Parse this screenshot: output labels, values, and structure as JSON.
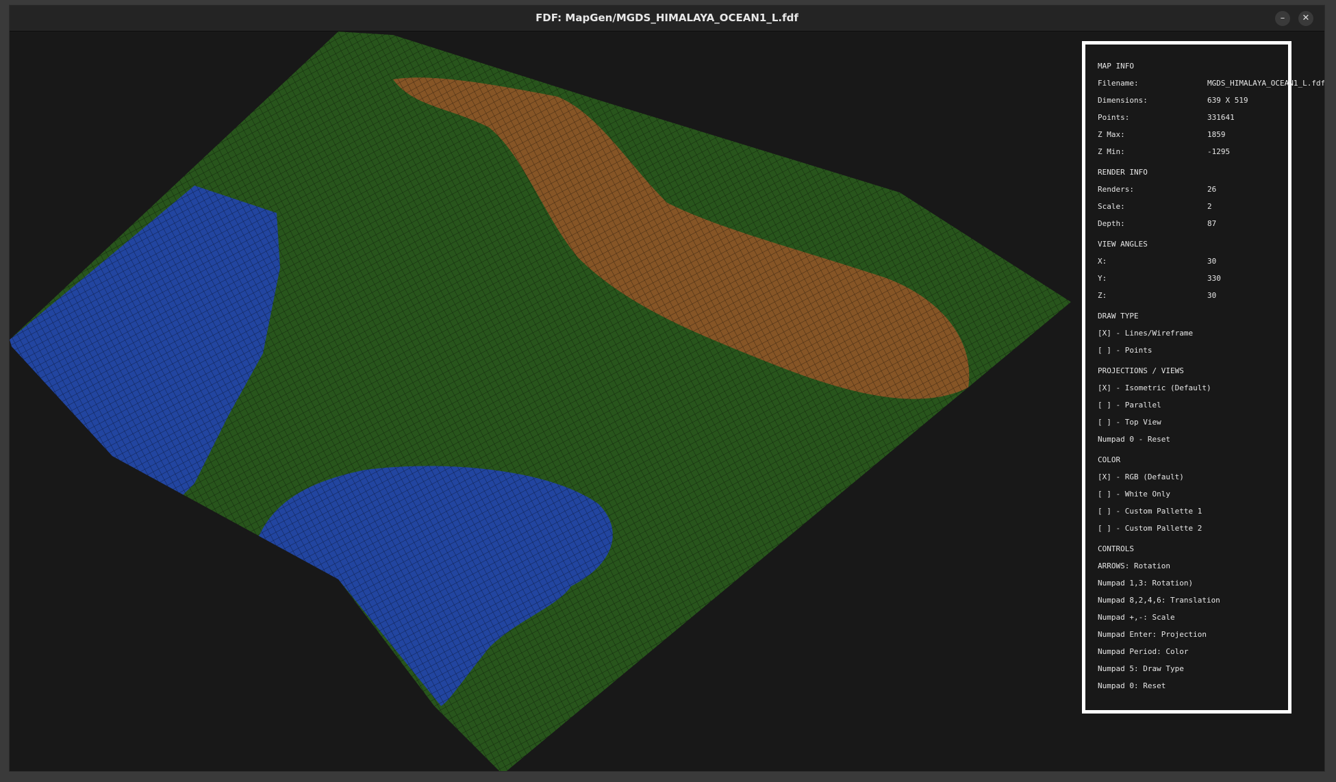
{
  "window": {
    "title": "FDF: MapGen/MGDS_HIMALAYA_OCEAN1_L.fdf",
    "minimize_glyph": "–",
    "close_glyph": "✕"
  },
  "colors": {
    "ocean": "#1f3fd8",
    "land": "#2d6a1e",
    "mountain": "#b8562c",
    "panel_border": "#ffffff",
    "background": "#181818"
  },
  "panel": {
    "map_info": {
      "header": "MAP INFO",
      "rows": [
        {
          "label": "Filename:",
          "value": "MGDS_HIMALAYA_OCEAN1_L.fdf"
        },
        {
          "label": "Dimensions:",
          "value": "639 X 519"
        },
        {
          "label": "Points:",
          "value": "331641"
        },
        {
          "label": "Z Max:",
          "value": "1859"
        },
        {
          "label": "Z Min:",
          "value": "-1295"
        }
      ]
    },
    "render_info": {
      "header": "RENDER INFO",
      "rows": [
        {
          "label": "Renders:",
          "value": "26"
        },
        {
          "label": "Scale:",
          "value": "2"
        },
        {
          "label": "Depth:",
          "value": "87"
        }
      ]
    },
    "view_angles": {
      "header": "VIEW ANGLES",
      "rows": [
        {
          "label": "X:",
          "value": "30"
        },
        {
          "label": "Y:",
          "value": "330"
        },
        {
          "label": "Z:",
          "value": "30"
        }
      ]
    },
    "draw_type": {
      "header": "DRAW TYPE",
      "items": [
        "[X] - Lines/Wireframe",
        "[ ] - Points"
      ]
    },
    "projections": {
      "header": "PROJECTIONS / VIEWS",
      "items": [
        "[X] - Isometric (Default)",
        "[ ] - Parallel",
        "[ ] - Top View",
        "Numpad 0 - Reset"
      ]
    },
    "color": {
      "header": "COLOR",
      "items": [
        "[X] - RGB (Default)",
        "[ ] - White Only",
        "[ ] - Custom Pallette 1",
        "[ ] - Custom Pallette 2"
      ]
    },
    "controls": {
      "header": "CONTROLS",
      "items": [
        "ARROWS: Rotation",
        "Numpad 1,3: Rotation)",
        "Numpad 8,2,4,6: Translation",
        "Numpad +,-: Scale",
        "Numpad Enter: Projection",
        "Numpad Period: Color",
        "Numpad 5: Draw Type",
        "Numpad 0: Reset"
      ]
    }
  }
}
